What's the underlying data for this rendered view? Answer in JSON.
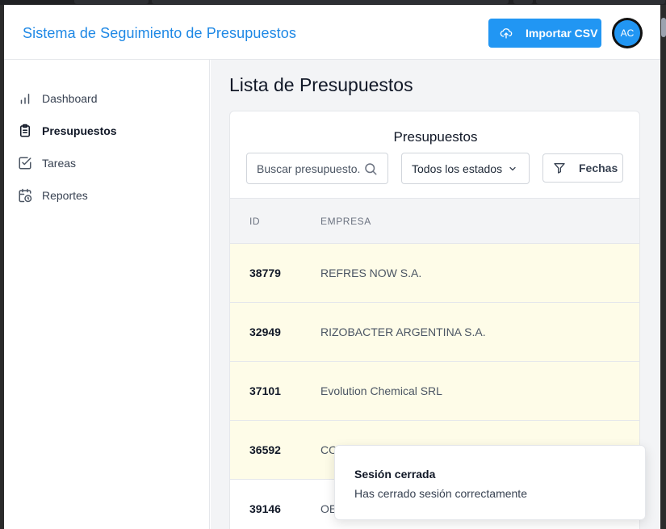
{
  "header": {
    "title": "Sistema de Seguimiento de Presupuestos",
    "import_label": "Importar CSV",
    "avatar_initials": "AC"
  },
  "sidebar": {
    "items": [
      {
        "label": "Dashboard",
        "icon": "bar-chart-icon"
      },
      {
        "label": "Presupuestos",
        "icon": "clipboard-list-icon",
        "active": true
      },
      {
        "label": "Tareas",
        "icon": "checkbox-icon"
      },
      {
        "label": "Reportes",
        "icon": "calendar-clock-icon"
      }
    ]
  },
  "main": {
    "page_title": "Lista de Presupuestos",
    "card": {
      "title": "Presupuestos",
      "search_placeholder": "Buscar presupuesto...",
      "status_filter": "Todos los estados",
      "dates_label": "Fechas",
      "columns": [
        "ID",
        "EMPRESA"
      ],
      "rows": [
        {
          "id": "38779",
          "empresa": "REFRES NOW S.A.",
          "highlight": true
        },
        {
          "id": "32949",
          "empresa": "RIZOBACTER ARGENTINA S.A.",
          "highlight": true
        },
        {
          "id": "37101",
          "empresa": "Evolution Chemical SRL",
          "highlight": true
        },
        {
          "id": "36592",
          "empresa": "CO",
          "highlight": true
        },
        {
          "id": "39146",
          "empresa": "OE",
          "highlight": false
        }
      ]
    }
  },
  "toast": {
    "title": "Sesión cerrada",
    "message": "Has cerrado sesión correctamente"
  },
  "colors": {
    "accent": "#2196f3",
    "title_blue": "#1e88e5",
    "row_highlight": "#fefce8"
  }
}
